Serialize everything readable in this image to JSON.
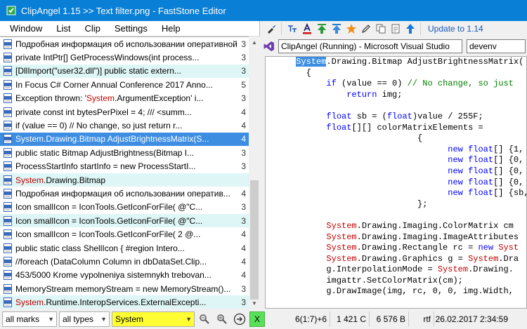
{
  "window": {
    "title": "ClipAngel 1.15 >> Text filter.png - FastStone Editor",
    "minimize": "—",
    "maximize": "☐",
    "close": "✕"
  },
  "menu": [
    "Window",
    "List",
    "Clip",
    "Settings",
    "Help"
  ],
  "list": {
    "rows": [
      {
        "text": "Подробная информация об использовании оперативной",
        "count": "3",
        "style": "plain"
      },
      {
        "text": "private IntPtr[] GetProcessWindows(int process...",
        "count": "3",
        "style": "plain"
      },
      {
        "text": "[DllImport(\"user32.dll\")] public static extern...",
        "count": "3",
        "style": "cyan"
      },
      {
        "text": "In Focus C# Corner Annual Conference 2017 Anno...",
        "count": "5",
        "style": "plain"
      },
      {
        "pre": "Exception thrown: '",
        "red": "System",
        "text": ".ArgumentException' i...",
        "count": "3",
        "style": "plain"
      },
      {
        "text": "private const int bytesPerPixel = 4; /// <summ...",
        "count": "4",
        "style": "plain"
      },
      {
        "text": "if (value == 0) // No change, so just return r...",
        "count": "4",
        "style": "plain"
      },
      {
        "text": "System.Drawing.Bitmap AdjustBrightnessMatrix(S...",
        "count": "4",
        "style": "sel"
      },
      {
        "text": "public static Bitmap AdjustBrightness(Bitmap I...",
        "count": "3",
        "style": "plain"
      },
      {
        "text": "ProcessStartInfo startInfo = new ProcessStartI...",
        "count": "3",
        "style": "plain"
      },
      {
        "red": "System",
        "text": ".Drawing.Bitmap",
        "count": "",
        "style": "cyan"
      },
      {
        "text": "Подробная информация об использовании оператив...",
        "count": "4",
        "style": "plain"
      },
      {
        "text": "Icon smallIcon = IconTools.GetIconForFile( @\"C...",
        "count": "3",
        "style": "plain"
      },
      {
        "text": "Icon smallIcon = IconTools.GetIconForFile( @\"C...",
        "count": "3",
        "style": "cyan"
      },
      {
        "text": "Icon smallIcon = IconTools.GetIconForFile( 2 @...",
        "count": "4",
        "style": "plain"
      },
      {
        "text": "public static class ShellIcon { #region Intero...",
        "count": "4",
        "style": "plain"
      },
      {
        "text": "//foreach (DataColumn Column in dbDataSet.Clip...",
        "count": "4",
        "style": "plain"
      },
      {
        "text": "453/5000 Krome vypolneniya sistemnykh trebovan...",
        "count": "4",
        "style": "plain"
      },
      {
        "text": "MemoryStream memoryStream = new MemoryStream()...",
        "count": "3",
        "style": "plain"
      },
      {
        "red": "System",
        "text": ".Runtime.InteropServices.ExternalExcepti...",
        "count": "3",
        "style": "cyan"
      }
    ]
  },
  "toolbar": {
    "update_link": "Update to 1.14"
  },
  "source_window": {
    "title": "ClipAngel (Running) - Microsoft Visual Studio",
    "process": "devenv"
  },
  "editor": {
    "lines": [
      [
        {
          "t": "      "
        },
        {
          "t": "System",
          "c": "hl"
        },
        {
          "t": ".Drawing.Bitmap AdjustBrightnessMatrix("
        }
      ],
      [
        {
          "t": "        {"
        }
      ],
      [
        {
          "t": "            "
        },
        {
          "t": "if",
          "c": "kw"
        },
        {
          "t": " (value == 0) "
        },
        {
          "t": "// No change, so just",
          "c": "cm"
        }
      ],
      [
        {
          "t": "                "
        },
        {
          "t": "return",
          "c": "kw"
        },
        {
          "t": " img;"
        }
      ],
      [
        {
          "t": ""
        }
      ],
      [
        {
          "t": "            "
        },
        {
          "t": "float",
          "c": "kw"
        },
        {
          "t": " sb = ("
        },
        {
          "t": "float",
          "c": "kw"
        },
        {
          "t": ")value / 255F;"
        }
      ],
      [
        {
          "t": "            "
        },
        {
          "t": "float",
          "c": "kw"
        },
        {
          "t": "[][] colorMatrixElements ="
        }
      ],
      [
        {
          "t": "                              {"
        }
      ],
      [
        {
          "t": "                                    "
        },
        {
          "t": "new",
          "c": "kw"
        },
        {
          "t": " "
        },
        {
          "t": "float",
          "c": "kw"
        },
        {
          "t": "[] {1,"
        }
      ],
      [
        {
          "t": "                                    "
        },
        {
          "t": "new",
          "c": "kw"
        },
        {
          "t": " "
        },
        {
          "t": "float",
          "c": "kw"
        },
        {
          "t": "[] {0,"
        }
      ],
      [
        {
          "t": "                                    "
        },
        {
          "t": "new",
          "c": "kw"
        },
        {
          "t": " "
        },
        {
          "t": "float",
          "c": "kw"
        },
        {
          "t": "[] {0,"
        }
      ],
      [
        {
          "t": "                                    "
        },
        {
          "t": "new",
          "c": "kw"
        },
        {
          "t": " "
        },
        {
          "t": "float",
          "c": "kw"
        },
        {
          "t": "[] {0,"
        }
      ],
      [
        {
          "t": "                                    "
        },
        {
          "t": "new",
          "c": "kw"
        },
        {
          "t": " "
        },
        {
          "t": "float",
          "c": "kw"
        },
        {
          "t": "[] {sb,"
        }
      ],
      [
        {
          "t": "                              };"
        }
      ],
      [
        {
          "t": ""
        }
      ],
      [
        {
          "t": "            "
        },
        {
          "t": "System",
          "c": "ty"
        },
        {
          "t": ".Drawing.Imaging.ColorMatrix cm"
        }
      ],
      [
        {
          "t": "            "
        },
        {
          "t": "System",
          "c": "ty"
        },
        {
          "t": ".Drawing.Imaging.ImageAttributes"
        }
      ],
      [
        {
          "t": "            "
        },
        {
          "t": "System",
          "c": "ty"
        },
        {
          "t": ".Drawing.Rectangle rc = "
        },
        {
          "t": "new",
          "c": "kw"
        },
        {
          "t": " "
        },
        {
          "t": "Syst",
          "c": "ty"
        }
      ],
      [
        {
          "t": "            "
        },
        {
          "t": "System",
          "c": "ty"
        },
        {
          "t": ".Drawing.Graphics g = "
        },
        {
          "t": "System",
          "c": "ty"
        },
        {
          "t": ".Dra"
        }
      ],
      [
        {
          "t": "            g.InterpolationMode = "
        },
        {
          "t": "System",
          "c": "ty"
        },
        {
          "t": ".Drawing."
        }
      ],
      [
        {
          "t": "            imgattr.SetColorMatrix(cm);"
        }
      ],
      [
        {
          "t": "            g.DrawImage(img, rc, 0, 0, img.Width,"
        }
      ]
    ]
  },
  "status": {
    "marks_filter": "all marks",
    "types_filter": "all types",
    "search_text": "System",
    "clear_label": "X",
    "position": "6(1:7)+6",
    "chars": "1 421 C",
    "size": "6 576 B",
    "format": "rtf",
    "datetime": "26.02.2017 2:34:59"
  },
  "colors": {
    "titlebar": "#0a7fd6",
    "selection": "#3d8ee3",
    "cyan_row": "#dff6f6",
    "search_highlight": "#ffff33",
    "keyword": "#0000ff",
    "comment": "#008000",
    "system_type": "#c00000"
  }
}
